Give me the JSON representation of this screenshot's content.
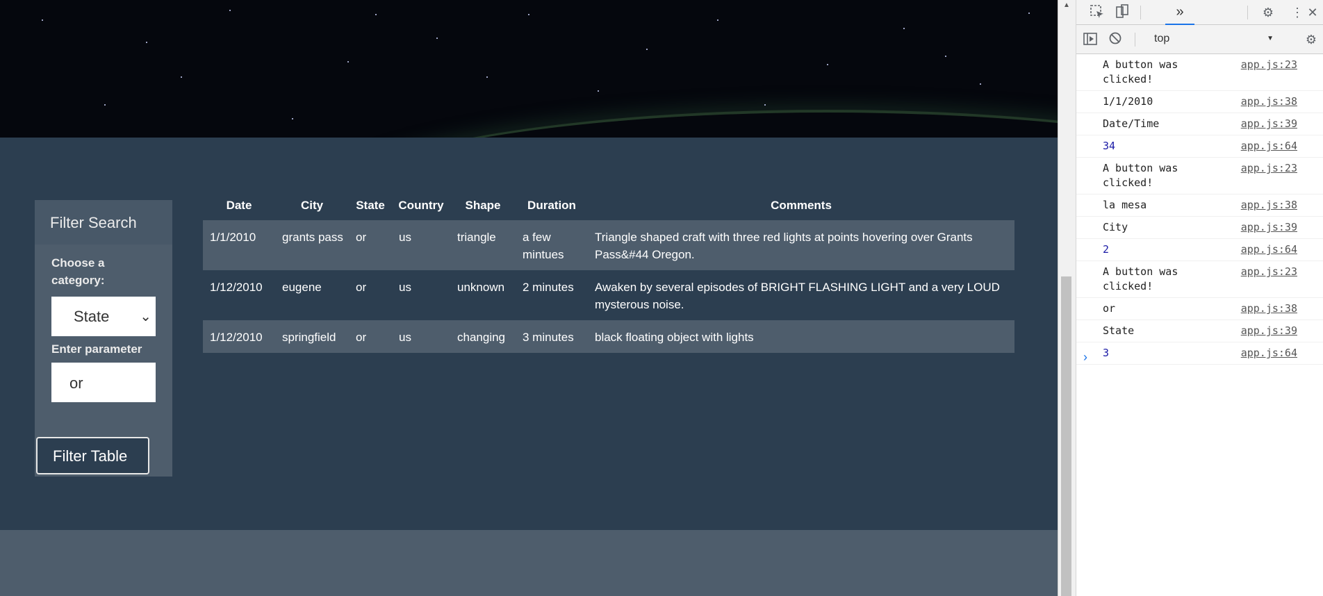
{
  "filter": {
    "header": "Filter Search",
    "category_label": "Choose a category:",
    "category_value": "State",
    "param_label": "Enter parameter",
    "param_value": "or",
    "button_label": "Filter Table"
  },
  "table": {
    "headers": [
      "Date",
      "City",
      "State",
      "Country",
      "Shape",
      "Duration",
      "Comments"
    ],
    "rows": [
      [
        "1/1/2010",
        "grants pass",
        "or",
        "us",
        "triangle",
        "a few mintues",
        "Triangle shaped craft with three red lights at points hovering over Grants Pass&#44 Oregon."
      ],
      [
        "1/12/2010",
        "eugene",
        "or",
        "us",
        "unknown",
        "2 minutes",
        "Awaken by several episodes of BRIGHT FLASHING LIGHT and a very LOUD mysterous noise."
      ],
      [
        "1/12/2010",
        "springfield",
        "or",
        "us",
        "changing",
        "3 minutes",
        "black floating object with lights"
      ]
    ]
  },
  "devtools": {
    "more_tabs_label": "»",
    "context": "top",
    "log": [
      {
        "msg": "A button was clicked!",
        "src": "app.js:23",
        "kind": "text"
      },
      {
        "msg": "1/1/2010",
        "src": "app.js:38",
        "kind": "text"
      },
      {
        "msg": "Date/Time",
        "src": "app.js:39",
        "kind": "text"
      },
      {
        "msg": "34",
        "src": "app.js:64",
        "kind": "number"
      },
      {
        "msg": "A button was clicked!",
        "src": "app.js:23",
        "kind": "text"
      },
      {
        "msg": "la mesa",
        "src": "app.js:38",
        "kind": "text"
      },
      {
        "msg": "City",
        "src": "app.js:39",
        "kind": "text"
      },
      {
        "msg": "2",
        "src": "app.js:64",
        "kind": "number"
      },
      {
        "msg": "A button was clicked!",
        "src": "app.js:23",
        "kind": "text"
      },
      {
        "msg": "or",
        "src": "app.js:38",
        "kind": "text"
      },
      {
        "msg": "State",
        "src": "app.js:39",
        "kind": "text"
      },
      {
        "msg": "3",
        "src": "app.js:64",
        "kind": "number"
      }
    ],
    "prompt": "›"
  },
  "icons": {
    "inspect": "inspect-element-icon",
    "device": "device-toolbar-icon",
    "settings": "settings-gear-icon",
    "menu": "kebab-menu-icon",
    "close": "close-icon",
    "sidebar": "show-sidebar-icon",
    "clear": "clear-console-icon",
    "console_settings": "console-settings-icon"
  }
}
